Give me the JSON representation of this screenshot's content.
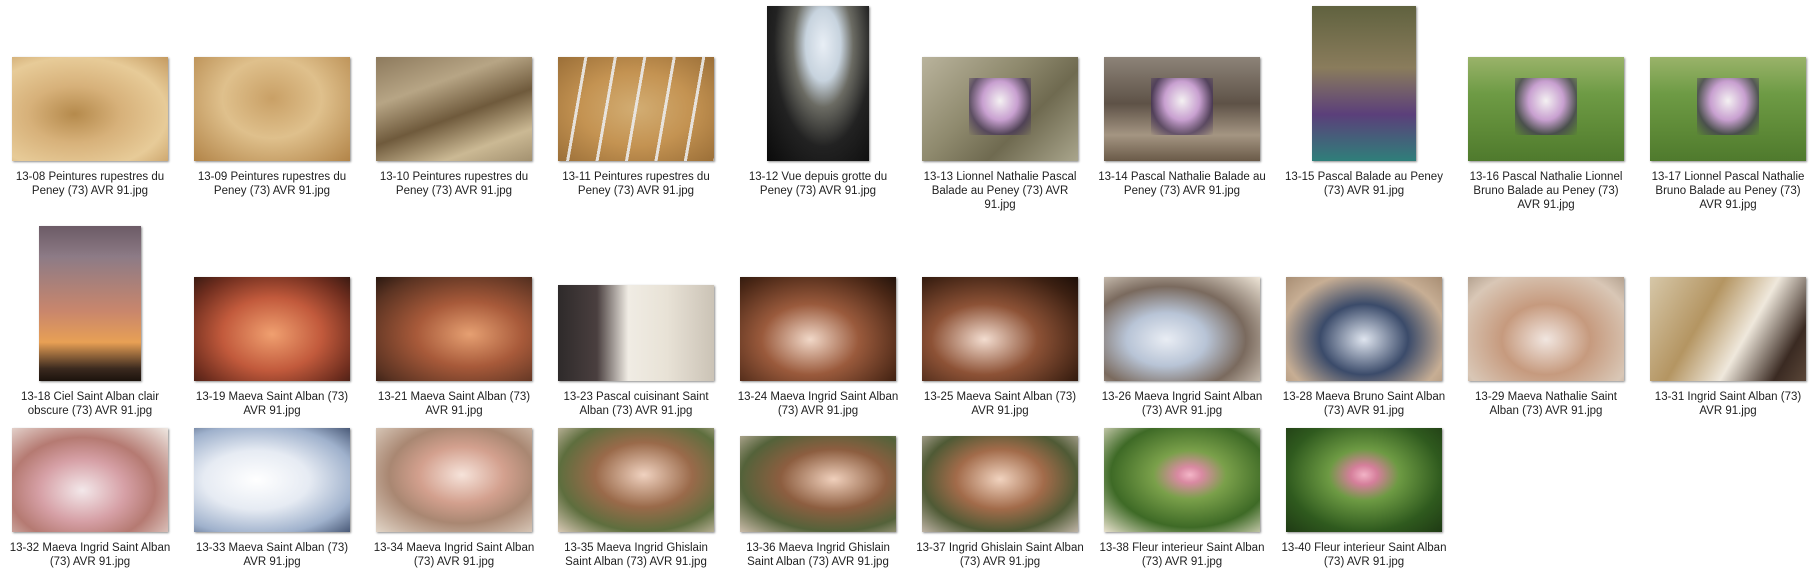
{
  "thumbnails": [
    {
      "label": "13-08 Peintures rupestres du Peney (73) AVR 91.jpg"
    },
    {
      "label": "13-09 Peintures rupestres du Peney (73) AVR 91.jpg"
    },
    {
      "label": "13-10 Peintures rupestres du Peney (73) AVR 91.jpg"
    },
    {
      "label": "13-11 Peintures rupestres du Peney (73) AVR 91.jpg"
    },
    {
      "label": "13-12 Vue depuis grotte du Peney (73) AVR 91.jpg"
    },
    {
      "label": "13-13 Lionnel Nathalie Pascal Balade au Peney (73) AVR 91.jpg"
    },
    {
      "label": "13-14 Pascal Nathalie Balade au Peney (73) AVR 91.jpg"
    },
    {
      "label": "13-15 Pascal Balade au Peney (73) AVR 91.jpg"
    },
    {
      "label": "13-16 Pascal Nathalie Lionnel Bruno Balade au Peney (73) AVR 91.jpg"
    },
    {
      "label": "13-17 Lionnel Pascal Nathalie Bruno Balade au Peney (73) AVR 91.jpg"
    },
    {
      "label": "13-18 Ciel Saint Alban clair obscure (73) AVR 91.jpg"
    },
    {
      "label": "13-19 Maeva Saint Alban (73) AVR 91.jpg"
    },
    {
      "label": "13-21 Maeva Saint Alban (73) AVR 91.jpg"
    },
    {
      "label": "13-23 Pascal cuisinant Saint Alban (73) AVR 91.jpg"
    },
    {
      "label": "13-24 Maeva Ingrid Saint Alban (73) AVR 91.jpg"
    },
    {
      "label": "13-25 Maeva Saint Alban (73) AVR 91.jpg"
    },
    {
      "label": "13-26 Maeva Ingrid Saint Alban (73) AVR 91.jpg"
    },
    {
      "label": "13-28 Maeva Bruno Saint Alban (73) AVR 91.jpg"
    },
    {
      "label": "13-29 Maeva Nathalie Saint Alban (73) AVR 91.jpg"
    },
    {
      "label": "13-31 Ingrid Saint Alban (73) AVR 91.jpg"
    },
    {
      "label": "13-32 Maeva Ingrid Saint Alban (73) AVR 91.jpg"
    },
    {
      "label": "13-33 Maeva Saint Alban (73) AVR 91.jpg"
    },
    {
      "label": "13-34 Maeva Ingrid Saint Alban (73) AVR 91.jpg"
    },
    {
      "label": "13-35 Maeva Ingrid Ghislain Saint Alban (73) AVR 91.jpg"
    },
    {
      "label": "13-36 Maeva Ingrid Ghislain Saint Alban (73) AVR 91.jpg"
    },
    {
      "label": "13-37 Ingrid Ghislain Saint Alban (73) AVR 91.jpg"
    },
    {
      "label": "13-38 Fleur interieur Saint Alban (73) AVR 91.jpg"
    },
    {
      "label": "13-40 Fleur interieur Saint Alban (73) AVR 91.jpg"
    }
  ]
}
